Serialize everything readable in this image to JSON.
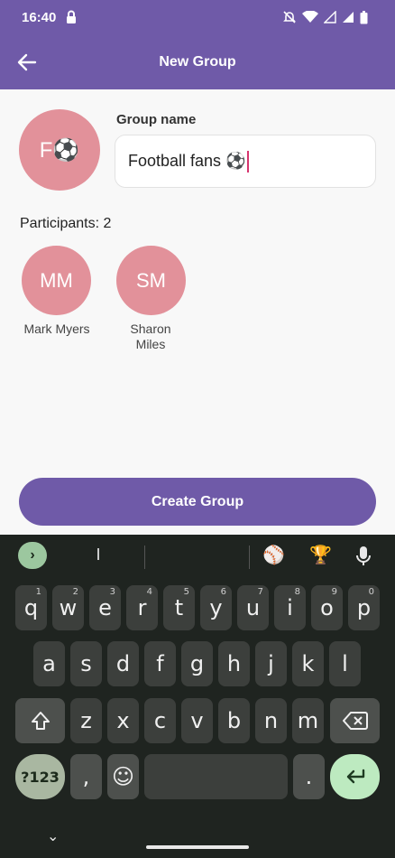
{
  "status": {
    "time": "16:40",
    "icons": [
      "lock-icon",
      "mute-icon",
      "wifi-icon",
      "signal-icon",
      "signal-r-icon",
      "battery-icon"
    ]
  },
  "appbar": {
    "title": "New Group",
    "back_icon": "arrow-left-icon"
  },
  "group": {
    "avatar_text": "F⚽",
    "name_label": "Group name",
    "name_value": "Football fans ⚽"
  },
  "participants": {
    "label": "Participants: 2",
    "items": [
      {
        "initials": "MM",
        "name": "Mark  Myers"
      },
      {
        "initials": "SM",
        "name_line1": "Sharon",
        "name_line2": "Miles"
      }
    ]
  },
  "create_button": {
    "label": "Create Group"
  },
  "colors": {
    "accent": "#6f5aa8",
    "avatar": "#e2919a",
    "keyboard_bg": "#1f2420"
  },
  "keyboard": {
    "suggestion": "I",
    "emoji_1": "⚾",
    "emoji_2": "🏆",
    "row1": [
      {
        "k": "q",
        "h": "1"
      },
      {
        "k": "w",
        "h": "2"
      },
      {
        "k": "e",
        "h": "3"
      },
      {
        "k": "r",
        "h": "4"
      },
      {
        "k": "t",
        "h": "5"
      },
      {
        "k": "y",
        "h": "6"
      },
      {
        "k": "u",
        "h": "7"
      },
      {
        "k": "i",
        "h": "8"
      },
      {
        "k": "o",
        "h": "9"
      },
      {
        "k": "p",
        "h": "0"
      }
    ],
    "row2": [
      "a",
      "s",
      "d",
      "f",
      "g",
      "h",
      "j",
      "k",
      "l"
    ],
    "row3": [
      "z",
      "x",
      "c",
      "v",
      "b",
      "n",
      "m"
    ],
    "sym_label": "?123",
    "comma": ",",
    "period": ".",
    "emoji_key": "☺",
    "shift_icon": "shift-icon",
    "delete_icon": "backspace-icon",
    "enter_icon": "enter-icon",
    "nav_hint": "⌄"
  }
}
